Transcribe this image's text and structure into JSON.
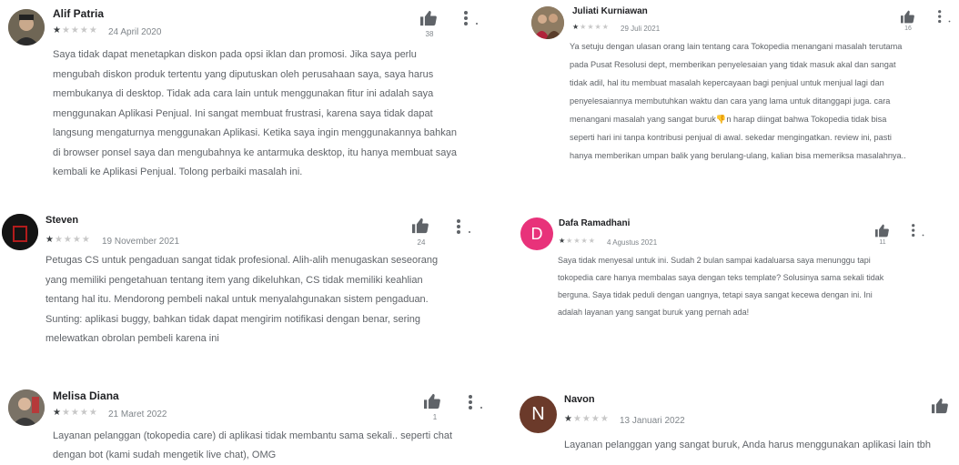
{
  "colors": {
    "dafa_avatar": "#e8327a",
    "navon_avatar": "#6b3a2a"
  },
  "reviews": [
    {
      "author": "Alif Patria",
      "stars": 1,
      "date": "24 April 2020",
      "likes": "38",
      "lines": [
        "Saya tidak dapat menetapkan diskon pada opsi iklan dan promosi. Jika saya perlu",
        "mengubah diskon produk tertentu yang diputuskan oleh perusahaan saya, saya harus",
        "membukanya di desktop. Tidak ada cara lain untuk menggunakan fitur ini adalah saya",
        "menggunakan Aplikasi Penjual. Ini sangat membuat frustrasi, karena saya tidak dapat",
        "langsung mengaturnya menggunakan Aplikasi. Ketika saya ingin menggunakannya bahkan",
        "di browser ponsel saya dan mengubahnya ke antarmuka desktop, itu hanya membuat saya",
        "kembali ke Aplikasi Penjual. Tolong perbaiki masalah ini."
      ]
    },
    {
      "author": "Juliati Kurniawan",
      "stars": 1,
      "date": "29 Juli 2021",
      "likes": "16",
      "lines": [
        "Ya setuju dengan ulasan orang lain tentang cara Tokopedia menangani masalah terutama",
        "pada Pusat Resolusi dept, memberikan penyelesaian yang tidak masuk akal dan sangat",
        "tidak adil, hal itu membuat masalah kepercayaan bagi penjual untuk menjual lagi dan",
        "penyelesaiannya membutuhkan waktu dan cara yang lama untuk ditanggapi juga. cara",
        "menangani masalah yang sangat buruk👎n harap diingat bahwa Tokopedia tidak bisa",
        "seperti hari ini tanpa kontribusi penjual di awal. sekedar mengingatkan. review ini, pasti",
        "hanya memberikan umpan balik yang berulang-ulang, kalian bisa memeriksa masalahnya.."
      ]
    },
    {
      "author": "Steven",
      "stars": 1,
      "date": "19 November 2021",
      "likes": "24",
      "lines": [
        "Petugas CS untuk pengaduan sangat tidak profesional. Alih-alih menugaskan seseorang",
        "yang memiliki pengetahuan tentang item yang dikeluhkan, CS tidak memiliki keahlian",
        "tentang hal itu. Mendorong pembeli nakal untuk menyalahgunakan sistem pengaduan.",
        "Sunting: aplikasi buggy, bahkan tidak dapat mengirim notifikasi dengan benar, sering",
        "melewatkan obrolan pembeli karena ini"
      ]
    },
    {
      "author": "Dafa Ramadhani",
      "initial": "D",
      "stars": 1,
      "date": "4 Agustus 2021",
      "likes": "11",
      "lines": [
        "Saya tidak menyesal untuk ini. Sudah 2 bulan sampai kadaluarsa saya menunggu tapi",
        "tokopedia care hanya membalas saya dengan teks template? Solusinya sama sekali tidak",
        "berguna. Saya tidak peduli dengan uangnya, tetapi saya sangat kecewa dengan ini. Ini",
        "adalah layanan yang sangat buruk yang pernah ada!"
      ]
    },
    {
      "author": "Melisa Diana",
      "stars": 1,
      "date": "21 Maret 2022",
      "likes": "1",
      "lines": [
        "Layanan pelanggan (tokopedia care) di aplikasi tidak membantu sama sekali.. seperti chat",
        "dengan bot (kami sudah mengetik live chat), OMG"
      ]
    },
    {
      "author": "Navon",
      "initial": "N",
      "stars": 1,
      "date": "13 Januari 2022",
      "likes": "",
      "lines": [
        "Layanan pelanggan yang sangat buruk, Anda harus menggunakan aplikasi lain tbh"
      ]
    }
  ]
}
